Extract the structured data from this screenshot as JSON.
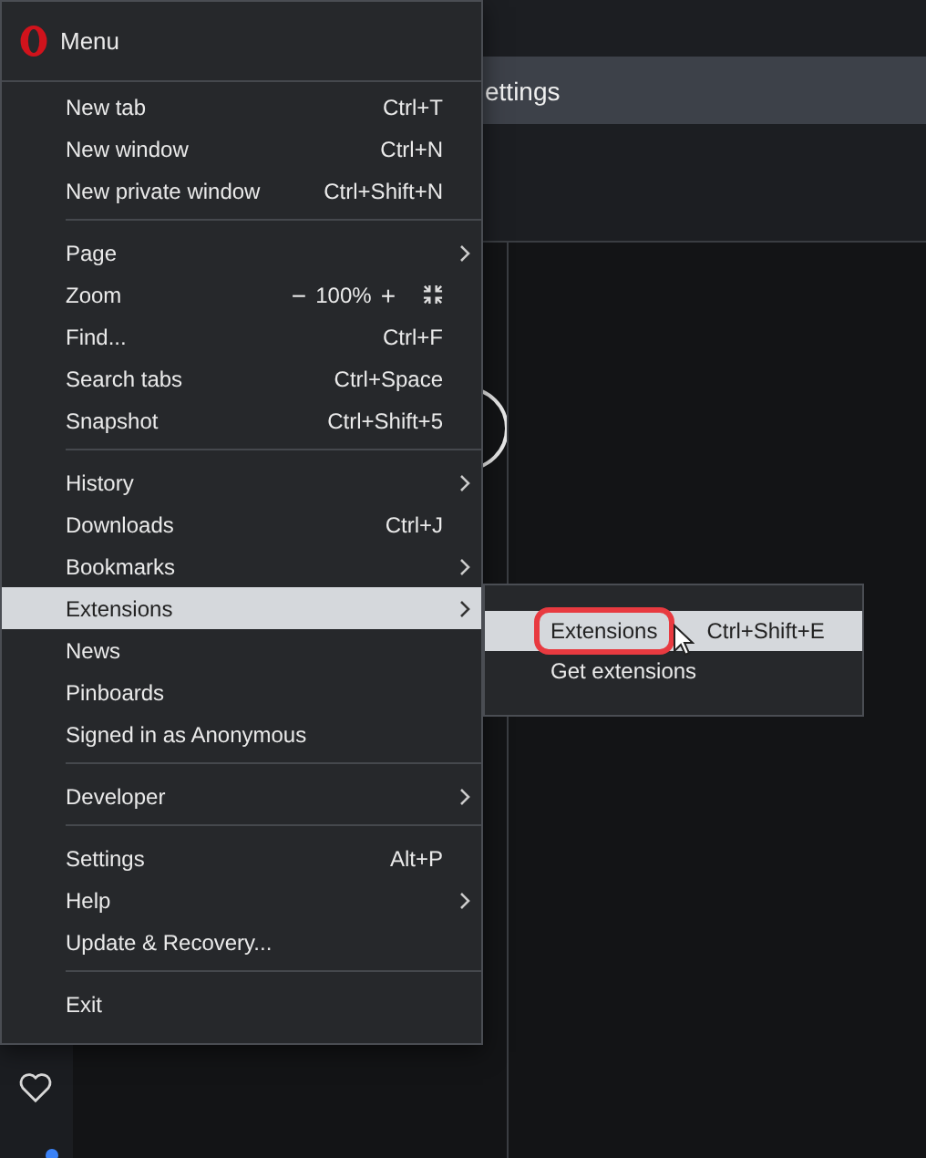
{
  "tab": {
    "title": "ettings"
  },
  "menu": {
    "title": "Menu",
    "groups": [
      [
        {
          "kind": "command",
          "label": "New tab",
          "shortcut": "Ctrl+T",
          "submenu": false,
          "selected": false
        },
        {
          "kind": "command",
          "label": "New window",
          "shortcut": "Ctrl+N",
          "submenu": false,
          "selected": false
        },
        {
          "kind": "command",
          "label": "New private window",
          "shortcut": "Ctrl+Shift+N",
          "submenu": false,
          "selected": false
        }
      ],
      [
        {
          "kind": "command",
          "label": "Page",
          "submenu": true,
          "selected": false
        },
        {
          "kind": "zoom",
          "label": "Zoom",
          "minus": "−",
          "value": "100%",
          "plus": "+",
          "submenu": false,
          "selected": false
        },
        {
          "kind": "command",
          "label": "Find...",
          "shortcut": "Ctrl+F",
          "submenu": false,
          "selected": false
        },
        {
          "kind": "command",
          "label": "Search tabs",
          "shortcut": "Ctrl+Space",
          "submenu": false,
          "selected": false
        },
        {
          "kind": "command",
          "label": "Snapshot",
          "shortcut": "Ctrl+Shift+5",
          "submenu": false,
          "selected": false
        }
      ],
      [
        {
          "kind": "command",
          "label": "History",
          "submenu": true,
          "selected": false
        },
        {
          "kind": "command",
          "label": "Downloads",
          "shortcut": "Ctrl+J",
          "submenu": false,
          "selected": false
        },
        {
          "kind": "command",
          "label": "Bookmarks",
          "submenu": true,
          "selected": false
        },
        {
          "kind": "command",
          "label": "Extensions",
          "submenu": true,
          "selected": true
        },
        {
          "kind": "command",
          "label": "News",
          "submenu": false,
          "selected": false
        },
        {
          "kind": "command",
          "label": "Pinboards",
          "submenu": false,
          "selected": false
        },
        {
          "kind": "command",
          "label": "Signed in as Anonymous",
          "submenu": false,
          "selected": false
        }
      ],
      [
        {
          "kind": "command",
          "label": "Developer",
          "submenu": true,
          "selected": false
        }
      ],
      [
        {
          "kind": "command",
          "label": "Settings",
          "shortcut": "Alt+P",
          "submenu": false,
          "selected": false
        },
        {
          "kind": "command",
          "label": "Help",
          "submenu": true,
          "selected": false
        },
        {
          "kind": "command",
          "label": "Update & Recovery...",
          "submenu": false,
          "selected": false
        }
      ],
      [
        {
          "kind": "command",
          "label": "Exit",
          "submenu": false,
          "selected": false
        }
      ]
    ]
  },
  "submenu": {
    "items": [
      {
        "label": "Extensions",
        "shortcut": "Ctrl+Shift+E",
        "selected": true,
        "outlined": true
      },
      {
        "label": "Get extensions",
        "selected": false,
        "outlined": false
      }
    ]
  }
}
